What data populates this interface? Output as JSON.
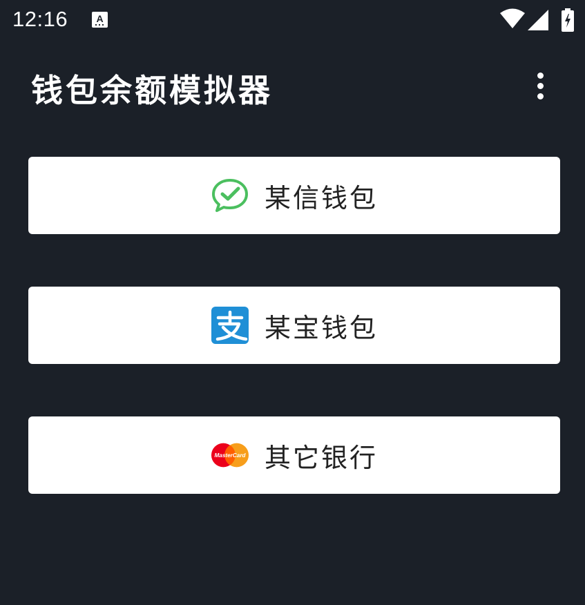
{
  "status_bar": {
    "time": "12:16",
    "notification_icon": "a-icon",
    "icons": [
      "wifi-icon",
      "signal-icon",
      "battery-charging-icon"
    ]
  },
  "app_bar": {
    "title": "钱包余额模拟器",
    "menu_icon": "more-vert-icon"
  },
  "wallets": [
    {
      "label": "某信钱包",
      "icon": "wechat-icon",
      "icon_color": "#4bbf5f"
    },
    {
      "label": "某宝钱包",
      "icon": "alipay-icon",
      "icon_color": "#1f8fd6"
    },
    {
      "label": "其它银行",
      "icon": "mastercard-icon",
      "icon_color": "#eb001b"
    }
  ],
  "colors": {
    "background": "#1b2028",
    "button": "#ffffff",
    "text_primary": "#222222",
    "mastercard_yellow": "#f79e1b"
  },
  "mastercard_logo_text": "MasterCard"
}
